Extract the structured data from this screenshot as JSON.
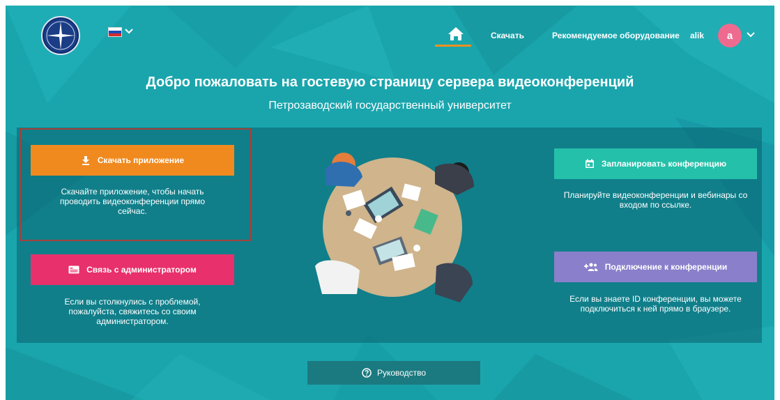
{
  "header": {
    "logo_icon": "university-logo",
    "language_icon": "russian-flag-icon",
    "nav": {
      "home_icon": "home-icon",
      "download": "Скачать",
      "equipment": "Рекомендуемое оборудование",
      "user_name": "alik",
      "avatar_letter": "a"
    }
  },
  "hero": {
    "title": "Добро пожаловать на гостевую страницу сервера видеоконференций",
    "subtitle": "Петрозаводский государственный университет"
  },
  "actions": {
    "download": {
      "icon": "download-icon",
      "label": "Скачать приложение",
      "description": "Скачайте приложение, чтобы начать проводить видеоконференции прямо сейчас."
    },
    "admin": {
      "icon": "contact-card-icon",
      "label": "Связь с администратором",
      "description": "Если вы столкнулись с проблемой, пожалуйста, свяжитесь со своим администратором."
    },
    "schedule": {
      "icon": "calendar-icon",
      "label": "Запланировать конференцию",
      "description": "Планируйте видеоконференции и вебинары со входом по ссылке."
    },
    "join": {
      "icon": "add-group-icon",
      "label": "Подключение к конференции",
      "description": "Если вы знаете ID конференции, вы можете подключиться к ней прямо в браузере."
    }
  },
  "guide": {
    "icon": "help-circle-icon",
    "label": "Руководство"
  },
  "colors": {
    "background": "#1aa5ad",
    "download": "#f08a1f",
    "admin": "#e8306c",
    "schedule": "#25c0a9",
    "join": "#8a7fcb",
    "home_underline": "#f0901f",
    "highlight_border": "#a3413a"
  }
}
